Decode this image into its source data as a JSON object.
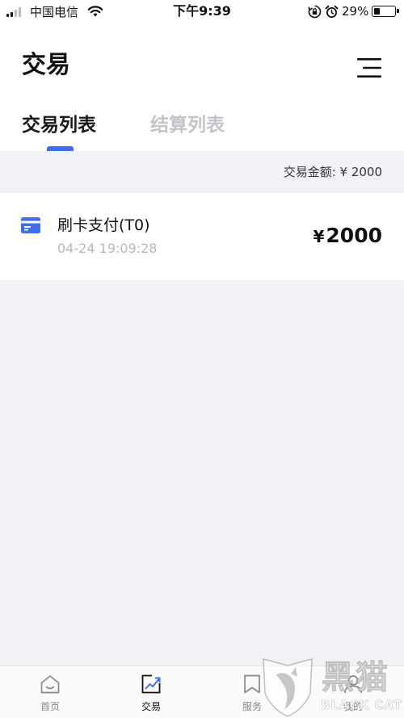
{
  "status_bar": {
    "carrier": "中国电信",
    "time": "下午9:39",
    "battery_percent_text": "29%",
    "battery_level": 0.29
  },
  "header": {
    "title": "交易",
    "menu_icon": "menu-lines-icon"
  },
  "tabs": [
    {
      "label": "交易列表",
      "active": true
    },
    {
      "label": "结算列表",
      "active": false
    }
  ],
  "summary": {
    "text": "交易金额: ¥ 2000"
  },
  "transactions": [
    {
      "icon": "card-icon",
      "title": "刷卡支付(T0)",
      "time": "04-24 19:09:28",
      "currency": "¥",
      "amount": "2000"
    }
  ],
  "tabbar": {
    "items": [
      {
        "label": "首页",
        "icon": "home-icon",
        "active": false
      },
      {
        "label": "交易",
        "icon": "trend-icon",
        "active": true
      },
      {
        "label": "服务",
        "icon": "bookmark-icon",
        "active": false
      },
      {
        "label": "我的",
        "icon": "user-icon",
        "active": false
      }
    ]
  },
  "watermark": {
    "title": "黑猫",
    "subtitle": "BLACK CAT"
  },
  "colors": {
    "accent": "#3f6ee8",
    "background": "#f2f2f6",
    "inactive_tab": "#c4c4c8"
  }
}
